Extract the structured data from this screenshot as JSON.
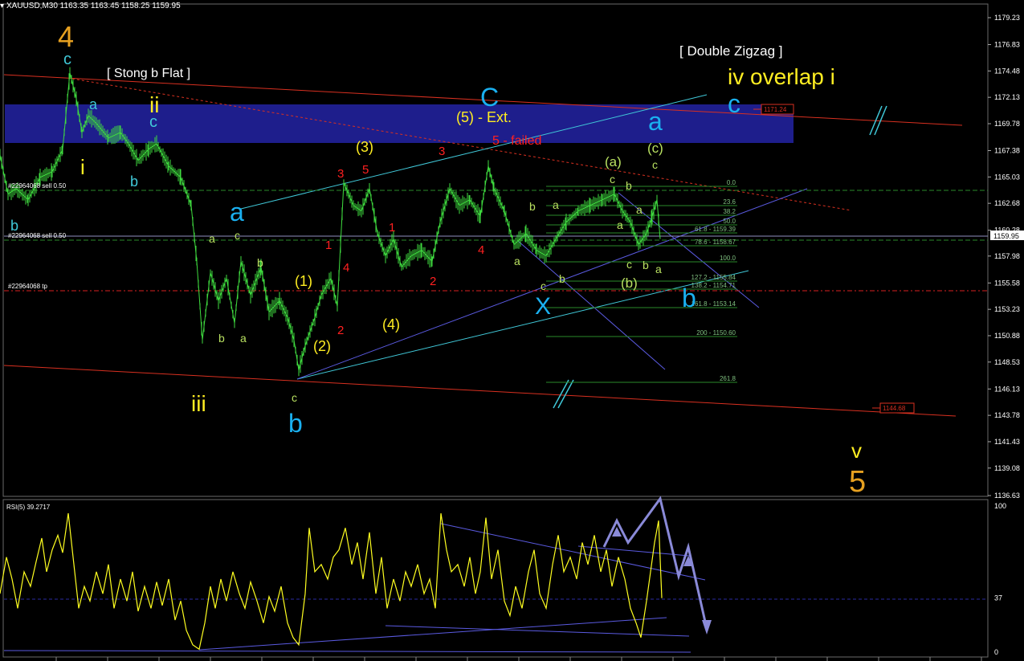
{
  "window": {
    "header": "XAUUSD,M30  1163.35 1163.45 1158.25 1159.95",
    "rsi_label": "RSI(5) 39.2717"
  },
  "colors": {
    "background": "#000000",
    "candle": "#3fdc3f",
    "rsi_line": "#ffff20",
    "resistance_zone": "#1e1e8c",
    "channel_red": "#d83020",
    "fib_green": "#2a8a2a",
    "trend_blue": "#5a5ae0",
    "trend_cyan": "#40c8d8",
    "wave_orange": "#e6a020",
    "wave_yellow": "#ffee22",
    "wave_cyan": "#40c8d8",
    "wave_blue": "#1ab0f0",
    "wave_red": "#ff2020",
    "wave_lime": "#b8e060",
    "projection_arrow": "#8a8ad8"
  },
  "chart_data": {
    "type": "candlestick",
    "symbol": "XAUUSD",
    "timeframe": "M30",
    "ohlc": {
      "open": 1163.35,
      "high": 1163.45,
      "low": 1158.25,
      "close": 1159.95
    },
    "price_axis": {
      "ticks": [
        "1179.23",
        "1176.83",
        "1174.48",
        "1172.13",
        "1169.78",
        "1167.38",
        "1165.03",
        "1162.68",
        "1160.28",
        "1157.98",
        "1155.58",
        "1153.23",
        "1150.88",
        "1148.53",
        "1146.13",
        "1143.78",
        "1141.43",
        "1139.08",
        "1136.63"
      ],
      "current_price": "1159.95",
      "ylim": [
        1135.9,
        1180.2
      ]
    },
    "price_path": [
      [
        0,
        1167.0
      ],
      [
        10,
        1163.5
      ],
      [
        20,
        1164.0
      ],
      [
        35,
        1163.0
      ],
      [
        50,
        1165.0
      ],
      [
        65,
        1165.5
      ],
      [
        78,
        1167.5
      ],
      [
        87,
        1174.3
      ],
      [
        95,
        1172.0
      ],
      [
        102,
        1169.0
      ],
      [
        110,
        1170.5
      ],
      [
        120,
        1169.8
      ],
      [
        135,
        1168.5
      ],
      [
        150,
        1169.0
      ],
      [
        160,
        1168.0
      ],
      [
        172,
        1166.5
      ],
      [
        185,
        1167.5
      ],
      [
        195,
        1168.0
      ],
      [
        210,
        1166.0
      ],
      [
        225,
        1165.0
      ],
      [
        238,
        1162.5
      ],
      [
        245,
        1157.5
      ],
      [
        252,
        1150.5
      ],
      [
        262,
        1156.5
      ],
      [
        272,
        1154.0
      ],
      [
        282,
        1156.0
      ],
      [
        292,
        1152.0
      ],
      [
        300,
        1157.5
      ],
      [
        312,
        1154.5
      ],
      [
        325,
        1157.0
      ],
      [
        335,
        1153.0
      ],
      [
        348,
        1154.0
      ],
      [
        358,
        1152.5
      ],
      [
        366,
        1150.5
      ],
      [
        372,
        1147.8
      ],
      [
        380,
        1150.0
      ],
      [
        392,
        1152.5
      ],
      [
        400,
        1154.5
      ],
      [
        412,
        1156.0
      ],
      [
        420,
        1153.5
      ],
      [
        428,
        1164.5
      ],
      [
        440,
        1162.5
      ],
      [
        450,
        1162.0
      ],
      [
        460,
        1164.0
      ],
      [
        470,
        1160.0
      ],
      [
        480,
        1158.0
      ],
      [
        490,
        1159.5
      ],
      [
        500,
        1157.0
      ],
      [
        512,
        1158.0
      ],
      [
        525,
        1158.5
      ],
      [
        538,
        1157.5
      ],
      [
        548,
        1161.0
      ],
      [
        560,
        1164.0
      ],
      [
        572,
        1162.5
      ],
      [
        585,
        1163.0
      ],
      [
        598,
        1161.5
      ],
      [
        608,
        1166.0
      ],
      [
        615,
        1164.0
      ],
      [
        628,
        1162.0
      ],
      [
        640,
        1159.0
      ],
      [
        655,
        1160.0
      ],
      [
        668,
        1158.5
      ],
      [
        680,
        1158.0
      ],
      [
        692,
        1159.5
      ],
      [
        705,
        1161.0
      ],
      [
        720,
        1162.0
      ],
      [
        735,
        1162.5
      ],
      [
        750,
        1163.0
      ],
      [
        765,
        1163.5
      ],
      [
        775,
        1162.0
      ],
      [
        785,
        1161.0
      ],
      [
        795,
        1159.0
      ],
      [
        805,
        1160.0
      ],
      [
        812,
        1161.5
      ],
      [
        818,
        1163.0
      ],
      [
        822,
        1159.5
      ]
    ],
    "resistance_zone": {
      "top": 1172.4,
      "bottom": 1169.1
    },
    "horizontal_lines": [
      {
        "label": "#22964068 sell 0.50",
        "price": 1164.8
      },
      {
        "label": "#22964068 sell 0.50",
        "price": 1160.0
      },
      {
        "label": "#22964068 tp",
        "price": 1155.35
      }
    ],
    "price_tags": [
      "1171.24",
      "1144.68"
    ],
    "fibonacci_levels": [
      {
        "label": "0.0"
      },
      {
        "label": "23.6"
      },
      {
        "label": "38.2"
      },
      {
        "label": "50.0"
      },
      {
        "label": "61.8 - 1159.39"
      },
      {
        "label": "78.6 - 1158.67"
      },
      {
        "label": "100.0"
      },
      {
        "label": "127.2 - 1155.84"
      },
      {
        "label": "138.2 - 1154.71"
      },
      {
        "label": "161.8 - 1153.14"
      },
      {
        "label": "200 - 1150.60"
      },
      {
        "label": "261.8"
      }
    ],
    "wave_labels": [
      {
        "text": "4",
        "color": "#e6a020"
      },
      {
        "text": "c",
        "color": "#40c8d8"
      },
      {
        "text": "[ Stong b Flat ]",
        "color": "#ffffff"
      },
      {
        "text": "a",
        "color": "#40c8d8"
      },
      {
        "text": "ii",
        "color": "#ffee22"
      },
      {
        "text": "c",
        "color": "#40c8d8"
      },
      {
        "text": "i",
        "color": "#ffee22"
      },
      {
        "text": "b",
        "color": "#40c8d8"
      },
      {
        "text": "b",
        "color": "#40c8d8"
      },
      {
        "text": "a",
        "color": "#1ab0f0"
      },
      {
        "text": "a",
        "color": "#b8e060"
      },
      {
        "text": "c",
        "color": "#b8e060"
      },
      {
        "text": "b",
        "color": "#b8e060"
      },
      {
        "text": "b",
        "color": "#b8e060"
      },
      {
        "text": "a",
        "color": "#b8e060"
      },
      {
        "text": "iii",
        "color": "#ffee22"
      },
      {
        "text": "c",
        "color": "#b8e060"
      },
      {
        "text": "b",
        "color": "#1ab0f0"
      },
      {
        "text": "(1)",
        "color": "#ffee22"
      },
      {
        "text": "(2)",
        "color": "#ffee22"
      },
      {
        "text": "(3)",
        "color": "#ffee22"
      },
      {
        "text": "(4)",
        "color": "#ffee22"
      },
      {
        "text": "(5) - Ext.",
        "color": "#ffee22"
      },
      {
        "text": "C",
        "color": "#1ab0f0"
      },
      {
        "text": "5 - failed",
        "color": "#ff2020"
      },
      {
        "text": "1",
        "color": "#ff2020"
      },
      {
        "text": "2",
        "color": "#ff2020"
      },
      {
        "text": "3",
        "color": "#ff2020"
      },
      {
        "text": "4",
        "color": "#ff2020"
      },
      {
        "text": "5",
        "color": "#ff2020"
      },
      {
        "text": "1",
        "color": "#ff2020"
      },
      {
        "text": "2",
        "color": "#ff2020"
      },
      {
        "text": "3",
        "color": "#ff2020"
      },
      {
        "text": "4",
        "color": "#ff2020"
      },
      {
        "text": "b",
        "color": "#b8e060"
      },
      {
        "text": "a",
        "color": "#b8e060"
      },
      {
        "text": "a",
        "color": "#b8e060"
      },
      {
        "text": "c",
        "color": "#b8e060"
      },
      {
        "text": "b",
        "color": "#b8e060"
      },
      {
        "text": "X",
        "color": "#1ab0f0"
      },
      {
        "text": "(a)",
        "color": "#b8e060"
      },
      {
        "text": "c",
        "color": "#b8e060"
      },
      {
        "text": "b",
        "color": "#b8e060"
      },
      {
        "text": "a",
        "color": "#b8e060"
      },
      {
        "text": "a",
        "color": "#b8e060"
      },
      {
        "text": "c",
        "color": "#b8e060"
      },
      {
        "text": "b",
        "color": "#b8e060"
      },
      {
        "text": "a",
        "color": "#b8e060"
      },
      {
        "text": "(b)",
        "color": "#b8e060"
      },
      {
        "text": "(c)",
        "color": "#b8e060"
      },
      {
        "text": "c",
        "color": "#b8e060"
      },
      {
        "text": "a",
        "color": "#1ab0f0"
      },
      {
        "text": "b",
        "color": "#1ab0f0"
      },
      {
        "text": "[ Double Zigzag ]",
        "color": "#ffffff"
      },
      {
        "text": "iv overlap i",
        "color": "#ffee22"
      },
      {
        "text": "c",
        "color": "#1ab0f0"
      },
      {
        "text": "v",
        "color": "#ffee22"
      },
      {
        "text": "5",
        "color": "#e6a020"
      }
    ],
    "rsi": {
      "name": "RSI(5)",
      "last": 39.2717,
      "levels": [
        "100",
        "37",
        "0"
      ],
      "level_line": 37,
      "ylim": [
        0,
        100
      ],
      "path": [
        [
          0,
          40
        ],
        [
          8,
          65
        ],
        [
          15,
          50
        ],
        [
          22,
          30
        ],
        [
          30,
          55
        ],
        [
          38,
          45
        ],
        [
          45,
          62
        ],
        [
          52,
          78
        ],
        [
          58,
          55
        ],
        [
          65,
          70
        ],
        [
          72,
          80
        ],
        [
          78,
          68
        ],
        [
          85,
          95
        ],
        [
          92,
          60
        ],
        [
          98,
          30
        ],
        [
          105,
          45
        ],
        [
          112,
          35
        ],
        [
          120,
          55
        ],
        [
          128,
          40
        ],
        [
          135,
          60
        ],
        [
          142,
          30
        ],
        [
          150,
          50
        ],
        [
          158,
          35
        ],
        [
          165,
          55
        ],
        [
          172,
          28
        ],
        [
          180,
          45
        ],
        [
          188,
          30
        ],
        [
          195,
          48
        ],
        [
          202,
          32
        ],
        [
          210,
          50
        ],
        [
          218,
          22
        ],
        [
          225,
          35
        ],
        [
          232,
          15
        ],
        [
          240,
          5
        ],
        [
          248,
          2
        ],
        [
          255,
          20
        ],
        [
          262,
          45
        ],
        [
          268,
          30
        ],
        [
          275,
          50
        ],
        [
          282,
          35
        ],
        [
          290,
          55
        ],
        [
          298,
          40
        ],
        [
          305,
          30
        ],
        [
          312,
          48
        ],
        [
          320,
          35
        ],
        [
          328,
          20
        ],
        [
          335,
          38
        ],
        [
          342,
          28
        ],
        [
          350,
          45
        ],
        [
          358,
          20
        ],
        [
          365,
          10
        ],
        [
          372,
          5
        ],
        [
          380,
          40
        ],
        [
          385,
          85
        ],
        [
          392,
          55
        ],
        [
          400,
          60
        ],
        [
          408,
          50
        ],
        [
          415,
          65
        ],
        [
          422,
          70
        ],
        [
          430,
          85
        ],
        [
          438,
          60
        ],
        [
          445,
          75
        ],
        [
          452,
          50
        ],
        [
          460,
          82
        ],
        [
          468,
          40
        ],
        [
          475,
          65
        ],
        [
          482,
          30
        ],
        [
          490,
          50
        ],
        [
          498,
          35
        ],
        [
          505,
          55
        ],
        [
          512,
          45
        ],
        [
          520,
          60
        ],
        [
          528,
          40
        ],
        [
          535,
          50
        ],
        [
          542,
          30
        ],
        [
          549,
          95
        ],
        [
          556,
          70
        ],
        [
          562,
          55
        ],
        [
          570,
          60
        ],
        [
          578,
          45
        ],
        [
          585,
          65
        ],
        [
          592,
          40
        ],
        [
          598,
          55
        ],
        [
          605,
          92
        ],
        [
          612,
          50
        ],
        [
          620,
          70
        ],
        [
          628,
          35
        ],
        [
          635,
          25
        ],
        [
          642,
          45
        ],
        [
          650,
          30
        ],
        [
          658,
          55
        ],
        [
          665,
          70
        ],
        [
          672,
          40
        ],
        [
          680,
          30
        ],
        [
          688,
          60
        ],
        [
          695,
          80
        ],
        [
          702,
          55
        ],
        [
          710,
          65
        ],
        [
          718,
          50
        ],
        [
          725,
          75
        ],
        [
          732,
          60
        ],
        [
          740,
          80
        ],
        [
          748,
          55
        ],
        [
          755,
          70
        ],
        [
          762,
          45
        ],
        [
          770,
          65
        ],
        [
          778,
          50
        ],
        [
          785,
          30
        ],
        [
          792,
          20
        ],
        [
          798,
          10
        ],
        [
          805,
          35
        ],
        [
          810,
          55
        ],
        [
          815,
          75
        ],
        [
          820,
          90
        ],
        [
          824,
          37
        ]
      ],
      "projection_path": [
        [
          752,
          72
        ],
        [
          768,
          90
        ],
        [
          782,
          75
        ],
        [
          822,
          105
        ],
        [
          845,
          52
        ],
        [
          857,
          72
        ],
        [
          880,
          16
        ]
      ]
    }
  }
}
